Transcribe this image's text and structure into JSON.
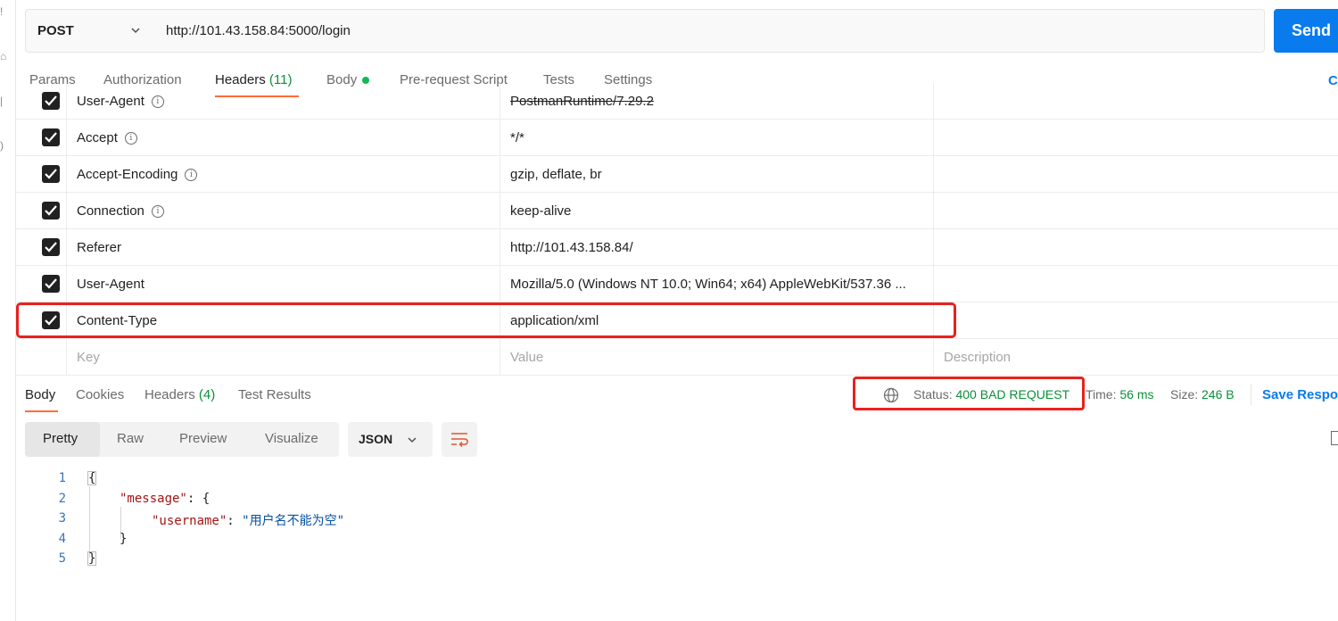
{
  "request": {
    "method": "POST",
    "url": "http://101.43.158.84:5000/login",
    "send_label": "Send",
    "tabs": [
      {
        "label": "Params"
      },
      {
        "label": "Authorization"
      },
      {
        "label": "Headers",
        "count": "(11)"
      },
      {
        "label": "Body"
      },
      {
        "label": "Pre-request Script"
      },
      {
        "label": "Tests"
      },
      {
        "label": "Settings"
      }
    ],
    "cookies_partial": "C"
  },
  "headers_table": {
    "rows": [
      {
        "key": "User-Agent",
        "value": "PostmanRuntime/7.29.2",
        "checked": true
      },
      {
        "key": "Accept",
        "value": "*/*",
        "checked": true
      },
      {
        "key": "Accept-Encoding",
        "value": "gzip, deflate, br",
        "checked": true
      },
      {
        "key": "Connection",
        "value": "keep-alive",
        "checked": true
      },
      {
        "key": "Referer",
        "value": "http://101.43.158.84/",
        "checked": true
      },
      {
        "key": "User-Agent",
        "value": "Mozilla/5.0 (Windows NT 10.0; Win64; x64) AppleWebKit/537.36 ...",
        "checked": true
      },
      {
        "key": "Content-Type",
        "value": "application/xml",
        "checked": true
      }
    ],
    "placeholders": {
      "key": "Key",
      "value": "Value",
      "description": "Description"
    }
  },
  "response": {
    "tabs": [
      {
        "label": "Body"
      },
      {
        "label": "Cookies"
      },
      {
        "label": "Headers",
        "count": "(4)"
      },
      {
        "label": "Test Results"
      }
    ],
    "status_label": "Status:",
    "status_value": "400 BAD REQUEST",
    "time_label": "Time:",
    "time_value": "56 ms",
    "size_label": "Size:",
    "size_value": "246 B",
    "save_label": "Save Respo",
    "views": [
      "Pretty",
      "Raw",
      "Preview",
      "Visualize"
    ],
    "format": "JSON",
    "code": {
      "line_numbers": [
        "1",
        "2",
        "3",
        "4",
        "5"
      ],
      "open_brace": "{",
      "message_key": "\"message\"",
      "username_key": "\"username\"",
      "username_value": "\"用户名不能为空\"",
      "inner_close": "}",
      "close_brace": "}",
      "colon_brace": ": {",
      "colon": ": "
    }
  },
  "colors": {
    "accent": "#ff6c37",
    "primary": "#097bed",
    "success": "#0c8f3a",
    "highlight": "#e8211c"
  }
}
